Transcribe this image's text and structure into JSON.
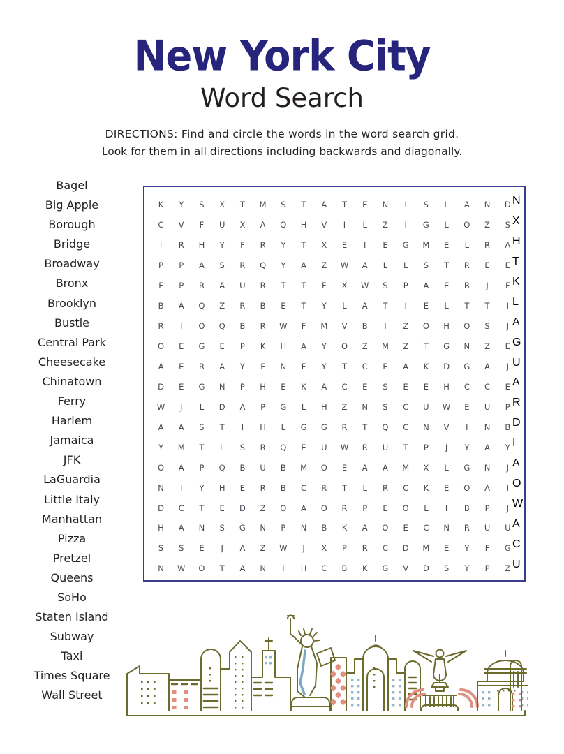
{
  "header": {
    "title": "New York City",
    "subtitle": "Word Search",
    "title_color": "#26247b",
    "subtitle_color": "#231f20"
  },
  "directions": {
    "line1": "DIRECTIONS:  Find and circle the words in the word search grid.",
    "line2": "Look for them in all directions including backwards and diagonally."
  },
  "word_list": {
    "words": [
      "Bagel",
      "Big Apple",
      "Borough",
      "Bridge",
      "Broadway",
      "Bronx",
      "Brooklyn",
      "Bustle",
      "Central Park",
      "Cheesecake",
      "Chinatown",
      "Ferry",
      "Harlem",
      "Jamaica",
      "JFK",
      "LaGuardia",
      "Little Italy",
      "Manhattan",
      "Pizza",
      "Pretzel",
      "Queens",
      "SoHo",
      "Staten Island",
      "Subway",
      "Taxi",
      "Times Square",
      "Wall Street"
    ],
    "count": 27
  },
  "puzzle": {
    "columns": 18,
    "rows": 19,
    "border_color": "#3b3b8f",
    "letter_color": "#4a4a55",
    "grid": [
      [
        "K",
        "Y",
        "S",
        "X",
        "T",
        "M",
        "S",
        "T",
        "A",
        "T",
        "E",
        "N",
        "I",
        "S",
        "L",
        "A",
        "N",
        "D"
      ],
      [
        "C",
        "V",
        "F",
        "U",
        "X",
        "A",
        "Q",
        "H",
        "V",
        "I",
        "L",
        "Z",
        "I",
        "G",
        "L",
        "O",
        "Z",
        "S"
      ],
      [
        "I",
        "R",
        "H",
        "Y",
        "F",
        "R",
        "Y",
        "T",
        "X",
        "E",
        "I",
        "E",
        "G",
        "M",
        "E",
        "L",
        "R",
        "A"
      ],
      [
        "P",
        "P",
        "A",
        "S",
        "R",
        "Q",
        "Y",
        "A",
        "Z",
        "W",
        "A",
        "L",
        "L",
        "S",
        "T",
        "R",
        "E",
        "E"
      ],
      [
        "F",
        "P",
        "R",
        "A",
        "U",
        "R",
        "T",
        "T",
        "F",
        "X",
        "W",
        "S",
        "P",
        "A",
        "E",
        "B",
        "J",
        "F"
      ],
      [
        "B",
        "A",
        "Q",
        "Z",
        "R",
        "B",
        "E",
        "T",
        "Y",
        "L",
        "A",
        "T",
        "I",
        "E",
        "L",
        "T",
        "T",
        "I"
      ],
      [
        "R",
        "I",
        "O",
        "Q",
        "B",
        "R",
        "W",
        "F",
        "M",
        "V",
        "B",
        "I",
        "Z",
        "O",
        "H",
        "O",
        "S",
        "J"
      ],
      [
        "O",
        "E",
        "G",
        "E",
        "P",
        "K",
        "H",
        "A",
        "Y",
        "O",
        "Z",
        "M",
        "Z",
        "T",
        "G",
        "N",
        "Z",
        "E"
      ],
      [
        "A",
        "E",
        "R",
        "A",
        "Y",
        "F",
        "N",
        "F",
        "Y",
        "T",
        "C",
        "E",
        "A",
        "K",
        "D",
        "G",
        "A",
        "J"
      ],
      [
        "D",
        "E",
        "G",
        "N",
        "P",
        "H",
        "E",
        "K",
        "A",
        "C",
        "E",
        "S",
        "E",
        "E",
        "H",
        "C",
        "C",
        "E"
      ],
      [
        "W",
        "J",
        "L",
        "D",
        "A",
        "P",
        "G",
        "L",
        "H",
        "Z",
        "N",
        "S",
        "C",
        "U",
        "W",
        "E",
        "U",
        "P"
      ],
      [
        "A",
        "A",
        "S",
        "T",
        "I",
        "H",
        "L",
        "G",
        "G",
        "R",
        "T",
        "Q",
        "C",
        "N",
        "V",
        "I",
        "N",
        "B"
      ],
      [
        "Y",
        "M",
        "T",
        "L",
        "S",
        "R",
        "Q",
        "E",
        "U",
        "W",
        "R",
        "U",
        "T",
        "P",
        "J",
        "Y",
        "A",
        "Y"
      ],
      [
        "O",
        "A",
        "P",
        "Q",
        "B",
        "U",
        "B",
        "M",
        "O",
        "E",
        "A",
        "A",
        "M",
        "X",
        "L",
        "G",
        "N",
        "J"
      ],
      [
        "N",
        "I",
        "Y",
        "H",
        "E",
        "R",
        "B",
        "C",
        "R",
        "T",
        "L",
        "R",
        "C",
        "K",
        "E",
        "Q",
        "A",
        "I"
      ],
      [
        "D",
        "C",
        "T",
        "E",
        "D",
        "Z",
        "O",
        "A",
        "O",
        "R",
        "P",
        "E",
        "O",
        "L",
        "I",
        "B",
        "P",
        "J"
      ],
      [
        "H",
        "A",
        "N",
        "S",
        "G",
        "N",
        "P",
        "N",
        "B",
        "K",
        "A",
        "O",
        "E",
        "C",
        "N",
        "R",
        "U",
        "U"
      ],
      [
        "S",
        "S",
        "E",
        "J",
        "A",
        "Z",
        "W",
        "J",
        "X",
        "P",
        "R",
        "C",
        "D",
        "M",
        "E",
        "Y",
        "F",
        "G"
      ],
      [
        "N",
        "W",
        "O",
        "T",
        "A",
        "N",
        "I",
        "H",
        "C",
        "B",
        "K",
        "G",
        "V",
        "D",
        "S",
        "Y",
        "P",
        "Z"
      ]
    ],
    "row_tails": [
      "N",
      "X",
      "H",
      "T",
      "K",
      "L",
      "A",
      "G",
      "U",
      "A",
      "R",
      "D",
      "I",
      "A",
      "O",
      "W",
      "A",
      "C",
      "U"
    ]
  },
  "skyline": {
    "outline_color": "#6b6b2e",
    "accent_salmon": "#e09080",
    "accent_blue": "#8fb6cc",
    "statue_drape_color": "#7aa8c4",
    "elements": [
      "low-rise-building",
      "dotted-window-block",
      "dashed-window-building",
      "domed-tower",
      "peaked-office-tower",
      "antenna-building",
      "statue-of-liberty",
      "diamond-pattern-tower",
      "cathedral-dome",
      "angel-fountain",
      "capitol-dome-building",
      "right-tower"
    ]
  }
}
